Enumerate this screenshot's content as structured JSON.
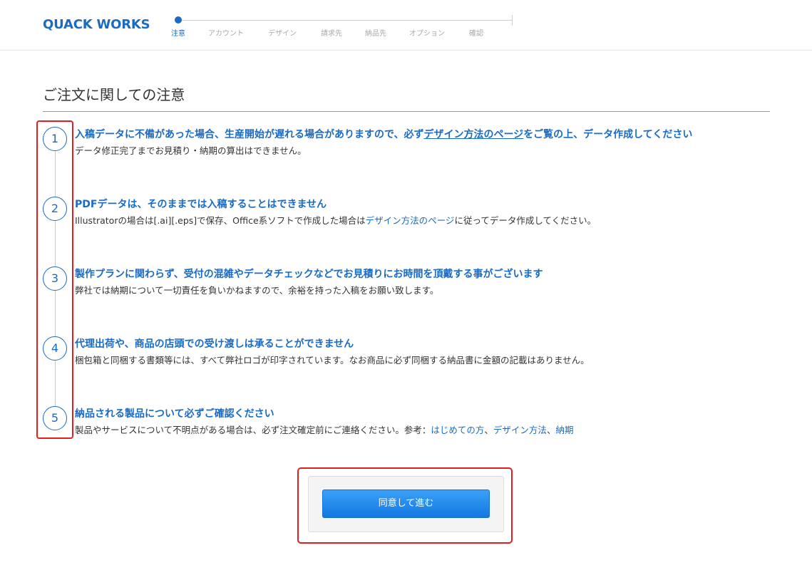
{
  "header": {
    "logo": "QUACK WORKS",
    "steps": [
      "注意",
      "アカウント",
      "デザイン",
      "請求先",
      "納品先",
      "オプション",
      "確認"
    ],
    "active_step": "注意"
  },
  "page_title": "ご注文に関しての注意",
  "notices": [
    {
      "number": "1",
      "heading_before": "入稿データに不備があった場合、生産開始が遅れる場合がありますので、必ず",
      "heading_link": "デザイン方法のページ",
      "heading_after": "をご覧の上、データ作成してください",
      "body": "データ修正完了までお見積り・納期の算出はできません。"
    },
    {
      "number": "2",
      "heading": "PDFデータは、そのままでは入稿することはできません",
      "body_before": "Illustratorの場合は[.ai][.eps]で保存、Office系ソフトで作成した場合は",
      "body_link": "デザイン方法のページ",
      "body_after": "に従ってデータ作成してください。"
    },
    {
      "number": "3",
      "heading": "製作プランに関わらず、受付の混雑やデータチェックなどでお見積りにお時間を頂戴する事がございます",
      "body": "弊社では納期について一切責任を負いかねますので、余裕を持った入稿をお願い致します。"
    },
    {
      "number": "4",
      "heading": "代理出荷や、商品の店頭での受け渡しは承ることができません",
      "body": "梱包箱と同梱する書類等には、すべて弊社ロゴが印字されています。なお商品に必ず同梱する納品書に金額の記載はありません。"
    },
    {
      "number": "5",
      "heading": "納品される製品について必ずご確認ください",
      "body_before": "製品やサービスについて不明点がある場合は、必ず注文確定前にご連絡ください。参考：",
      "links": [
        "はじめての方",
        "デザイン方法",
        "納期"
      ],
      "separator": "、"
    }
  ],
  "agree_button": "同意して進む",
  "colors": {
    "brand": "#1a6bc4",
    "highlight": "#e02020",
    "button": "#1278e2"
  }
}
